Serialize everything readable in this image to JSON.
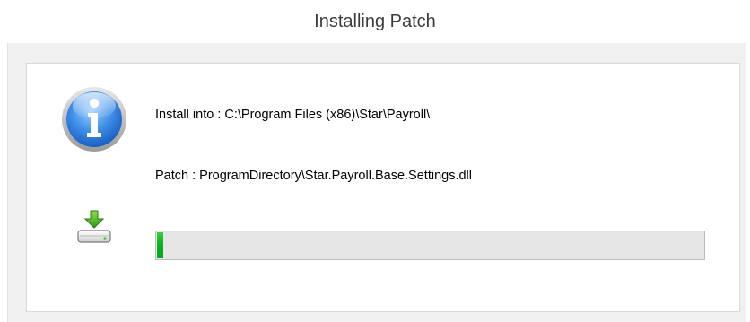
{
  "window": {
    "title": "Installing Patch"
  },
  "details": {
    "install_into": "Install into : C:\\Program Files (x86)\\Star\\Payroll\\",
    "patch": "Patch : ProgramDirectory\\Star.Payroll.Base.Settings.dll"
  },
  "progress": {
    "fraction": 0.012,
    "color": "#06b025"
  },
  "icons": {
    "info": "info-icon",
    "install": "install-download-icon"
  }
}
